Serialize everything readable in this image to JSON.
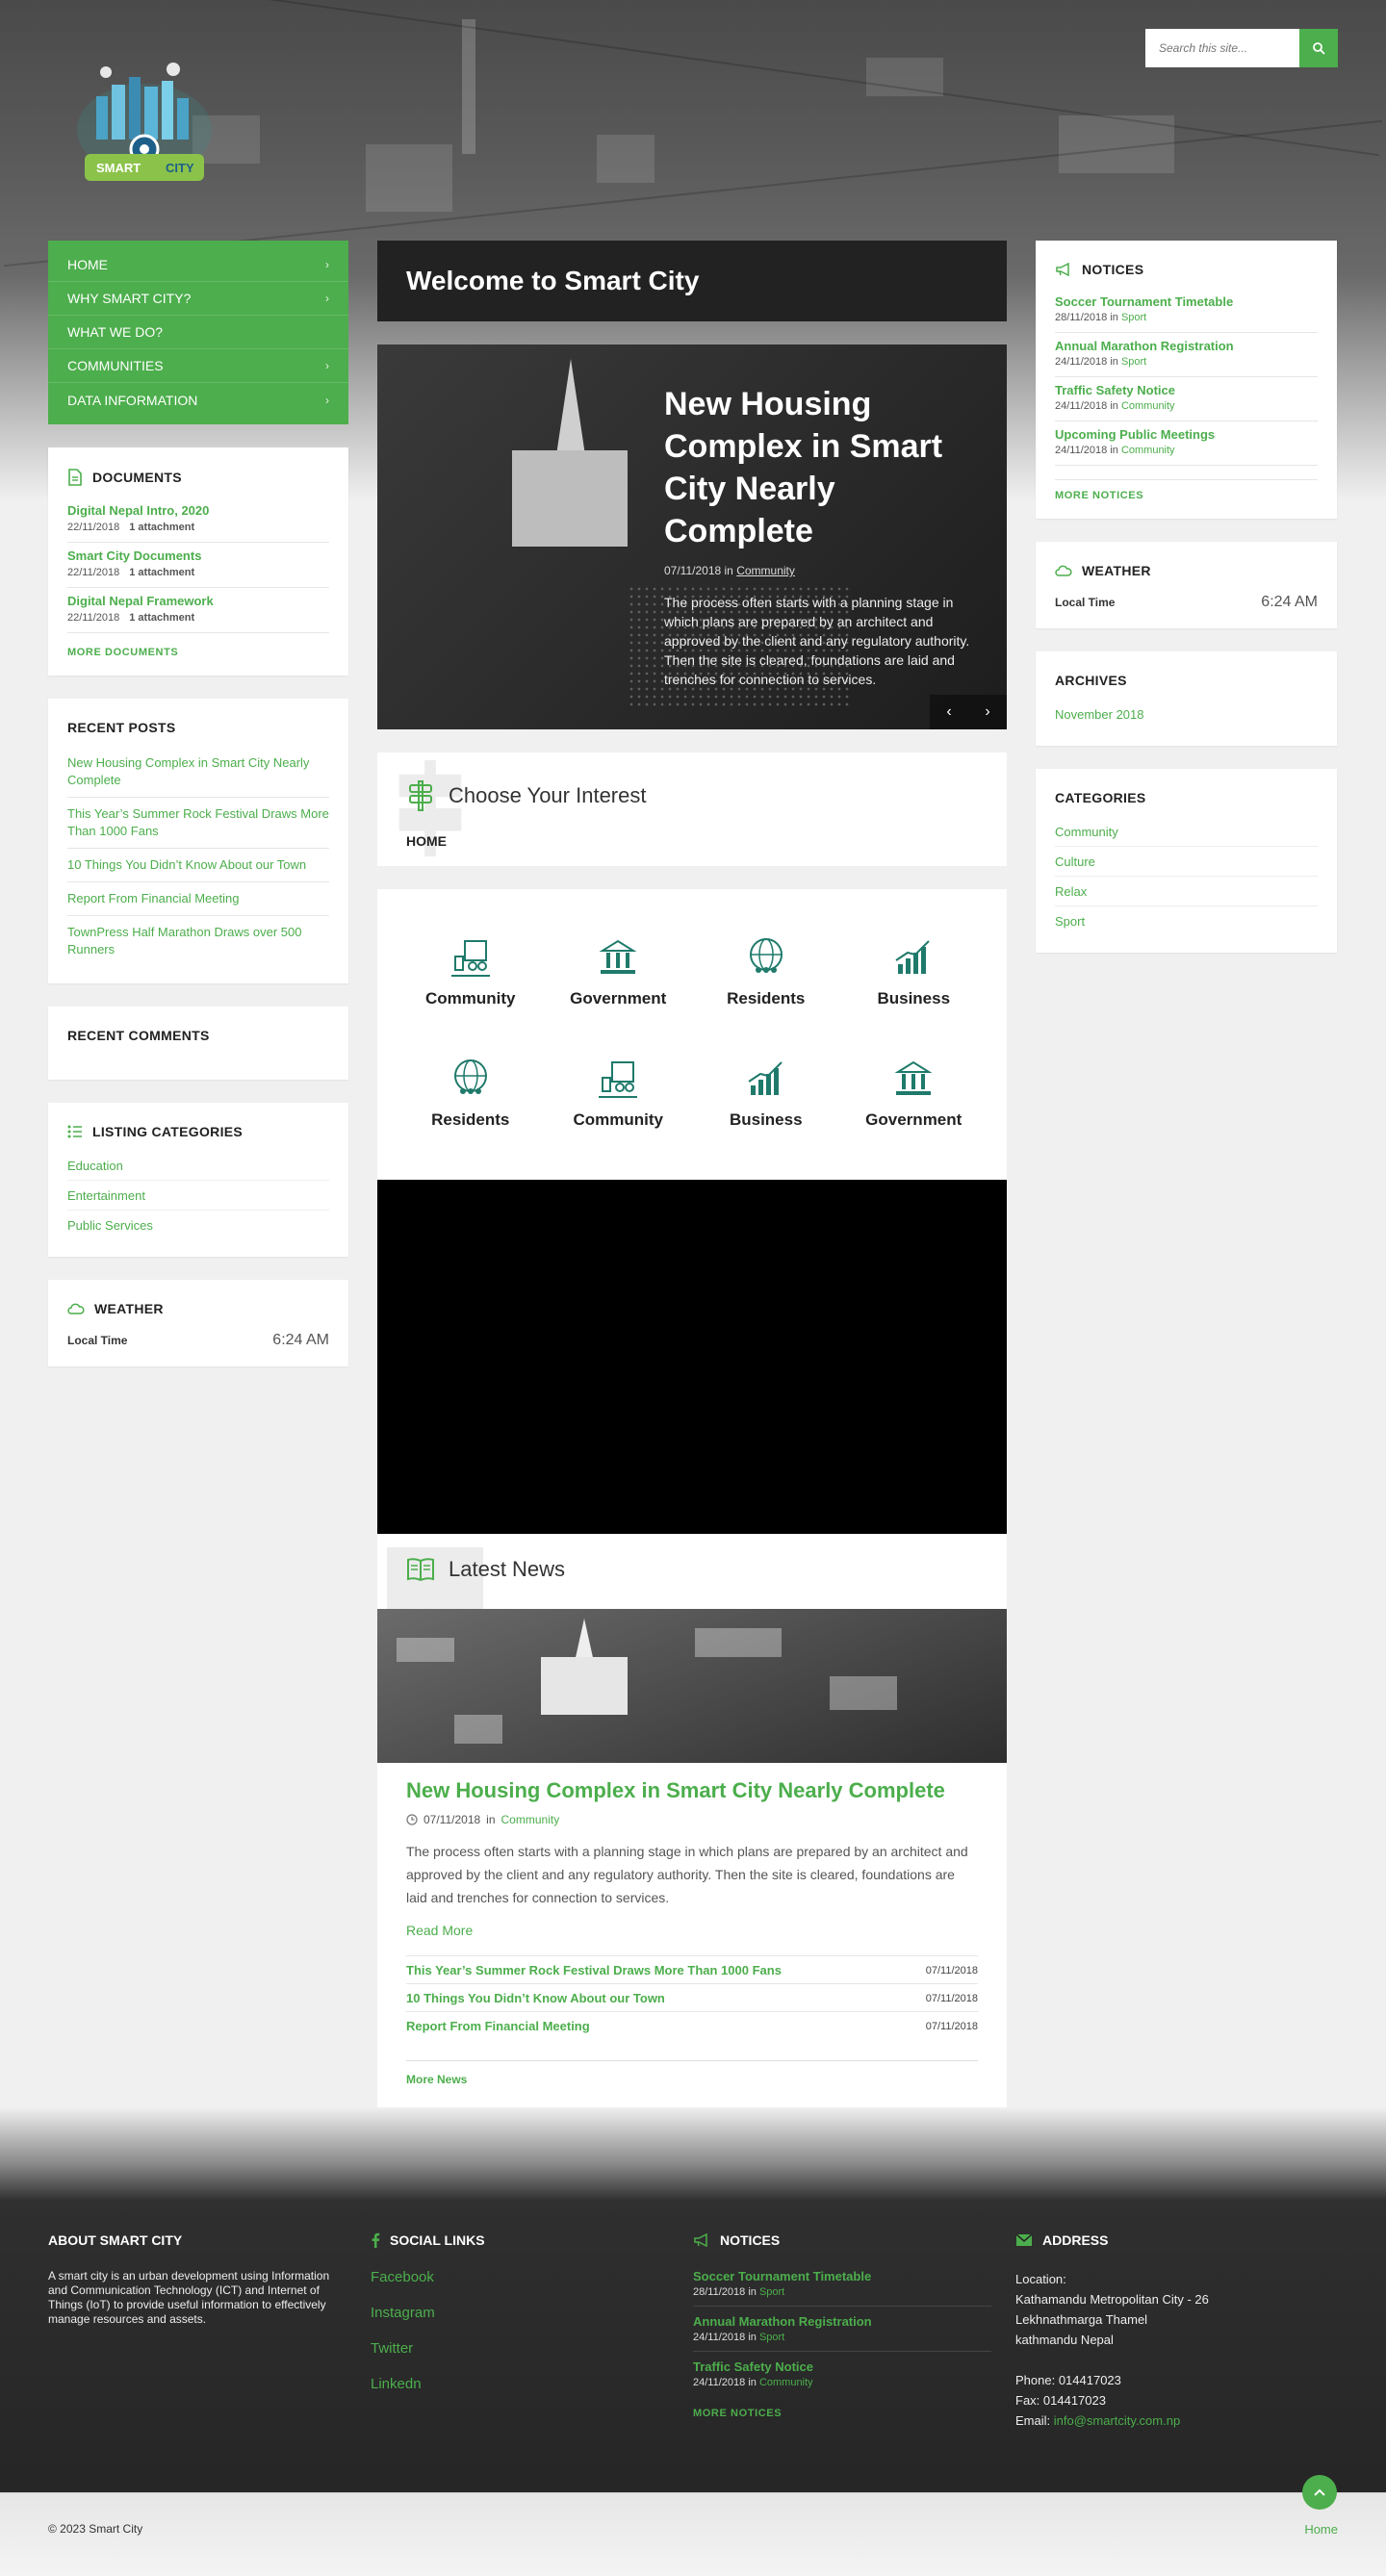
{
  "search": {
    "placeholder": "Search this site..."
  },
  "brand": {
    "logo_text": "SMART CITY",
    "accent": "#4cae4c"
  },
  "menu": [
    {
      "label": "HOME",
      "chevron": true
    },
    {
      "label": "WHY SMART CITY?",
      "chevron": true
    },
    {
      "label": "WHAT WE DO?",
      "chevron": false
    },
    {
      "label": "COMMUNITIES",
      "chevron": true
    },
    {
      "label": "DATA INFORMATION",
      "chevron": true
    }
  ],
  "documents": {
    "title": "DOCUMENTS",
    "items": [
      {
        "title": "Digital Nepal Intro, 2020",
        "date": "22/11/2018",
        "attach": "1 attachment"
      },
      {
        "title": "Smart City Documents",
        "date": "22/11/2018",
        "attach": "1 attachment"
      },
      {
        "title": "Digital Nepal Framework",
        "date": "22/11/2018",
        "attach": "1 attachment"
      }
    ],
    "more": "MORE DOCUMENTS"
  },
  "recent_posts": {
    "title": "RECENT POSTS",
    "items": [
      "New Housing Complex in Smart City Nearly Complete",
      "This Year’s Summer Rock Festival Draws More Than 1000 Fans",
      "10 Things You Didn’t Know About our Town",
      "Report From Financial Meeting",
      "TownPress Half Marathon Draws over 500 Runners"
    ]
  },
  "recent_comments": {
    "title": "RECENT COMMENTS"
  },
  "listing_categories": {
    "title": "LISTING CATEGORIES",
    "items": [
      "Education",
      "Entertainment",
      "Public Services"
    ]
  },
  "weather": {
    "title": "WEATHER",
    "label": "Local Time",
    "value": "6:24 AM"
  },
  "welcome": "Welcome to Smart City",
  "slider": {
    "title": "New Housing Complex in Smart City Nearly Complete",
    "date": "07/11/2018",
    "in": "in",
    "category": "Community",
    "excerpt": "The process often starts with a planning stage in which plans are prepared by an architect and approved by the client and any regulatory authority. Then the site is cleared, foundations are laid and trenches for connection to services.",
    "prev": "‹",
    "next": "›"
  },
  "interest": {
    "title": "Choose Your Interest",
    "tab": "HOME"
  },
  "interest_grid": [
    {
      "label": "Community",
      "icon": "community-icon"
    },
    {
      "label": "Government",
      "icon": "government-icon"
    },
    {
      "label": "Residents",
      "icon": "residents-icon"
    },
    {
      "label": "Business",
      "icon": "business-icon"
    },
    {
      "label": "Residents",
      "icon": "residents-icon"
    },
    {
      "label": "Community",
      "icon": "community-icon"
    },
    {
      "label": "Business",
      "icon": "business-icon"
    },
    {
      "label": "Government",
      "icon": "government-icon"
    }
  ],
  "latest_news": {
    "title": "Latest News",
    "featured": {
      "title": "New Housing Complex in Smart City Nearly Complete",
      "date": "07/11/2018",
      "in": "in",
      "category": "Community",
      "excerpt": "The process often starts with a planning stage in which plans are prepared by an architect and approved by the client and any regulatory authority. Then the site is cleared, foundations are laid and trenches for connection to services.",
      "read_more": "Read More"
    },
    "list": [
      {
        "title": "This Year’s Summer Rock Festival Draws More Than 1000 Fans",
        "date": "07/11/2018"
      },
      {
        "title": "10 Things You Didn’t Know About our Town",
        "date": "07/11/2018"
      },
      {
        "title": "Report From Financial Meeting",
        "date": "07/11/2018"
      }
    ],
    "more": "More News"
  },
  "notices": {
    "title": "NOTICES",
    "items": [
      {
        "title": "Soccer Tournament Timetable",
        "date": "28/11/2018",
        "in": "in",
        "category": "Sport"
      },
      {
        "title": "Annual Marathon Registration",
        "date": "24/11/2018",
        "in": "in",
        "category": "Sport"
      },
      {
        "title": "Traffic Safety Notice",
        "date": "24/11/2018",
        "in": "in",
        "category": "Community"
      },
      {
        "title": "Upcoming Public Meetings",
        "date": "24/11/2018",
        "in": "in",
        "category": "Community"
      }
    ],
    "more": "MORE NOTICES"
  },
  "archives": {
    "title": "ARCHIVES",
    "items": [
      "November 2018"
    ]
  },
  "categories": {
    "title": "CATEGORIES",
    "items": [
      "Community",
      "Culture",
      "Relax",
      "Sport"
    ]
  },
  "footer": {
    "about_title": "ABOUT SMART CITY",
    "about_text": "A smart city is an urban development using Information and Communication Technology (ICT) and Internet of Things (IoT) to provide useful information to effectively manage resources and assets.",
    "social_title": "SOCIAL LINKS",
    "social": [
      "Facebook",
      "Instagram",
      "Twitter",
      "Linkedn"
    ],
    "notices_title": "NOTICES",
    "notices": [
      {
        "title": "Soccer Tournament Timetable",
        "date": "28/11/2018",
        "in": "in",
        "category": "Sport"
      },
      {
        "title": "Annual Marathon Registration",
        "date": "24/11/2018",
        "in": "in",
        "category": "Sport"
      },
      {
        "title": "Traffic Safety Notice",
        "date": "24/11/2018",
        "in": "in",
        "category": "Community"
      }
    ],
    "notices_more": "MORE NOTICES",
    "address_title": "ADDRESS",
    "address_lines": [
      "Location:",
      "Kathamandu Metropolitan City - 26",
      "Lekhnathmarga Thamel",
      "kathmandu Nepal"
    ],
    "phone": "Phone: 014417023",
    "fax": "Fax: 014417023",
    "email_label": "Email:",
    "email": "info@smartcity.com.np"
  },
  "bottom": {
    "copyright": "© 2023 Smart City",
    "home": "Home"
  }
}
